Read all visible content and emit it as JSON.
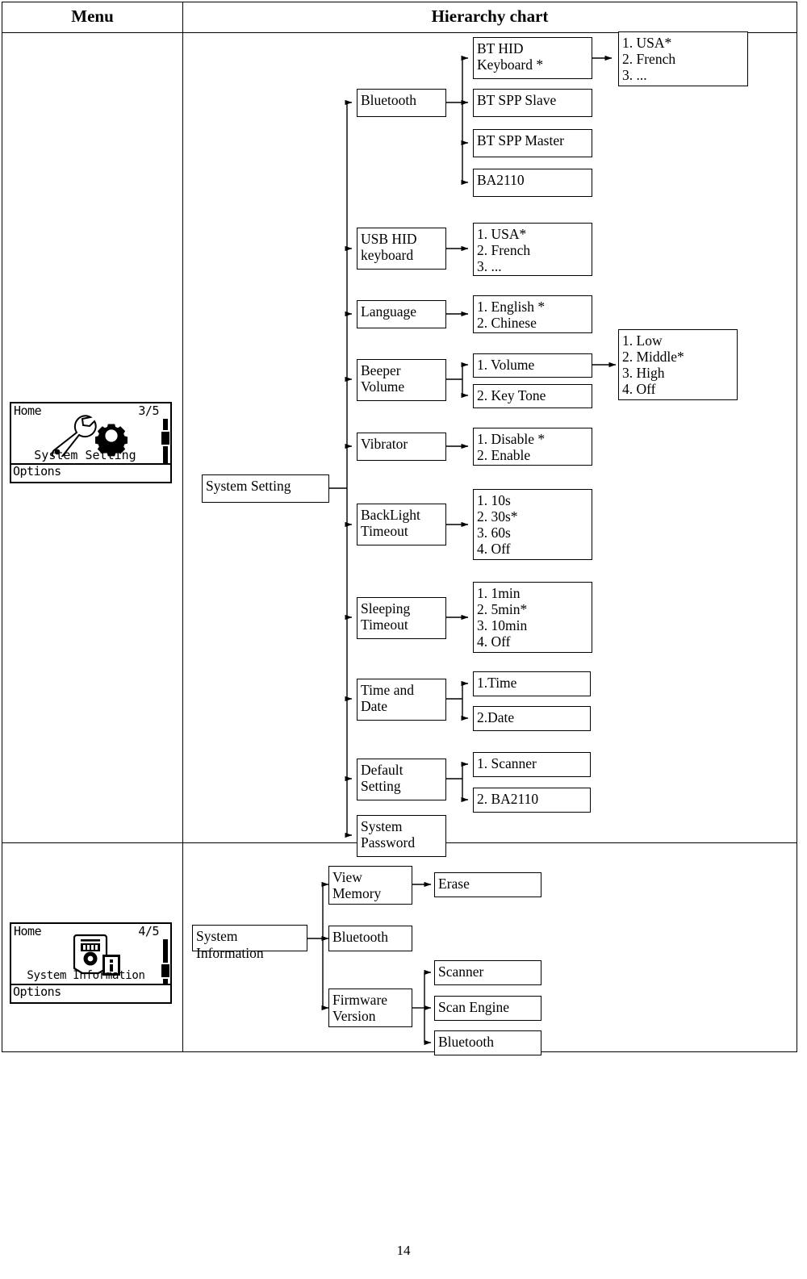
{
  "page": {
    "number": "14"
  },
  "table": {
    "headers": {
      "menu": "Menu",
      "hierarchy": "Hierarchy chart"
    }
  },
  "screens": [
    {
      "home_label": "Home",
      "page_indicator": "3/5",
      "caption": "System Setting",
      "status": "Options",
      "icon": "wrench-gear-icon"
    },
    {
      "home_label": "Home",
      "page_indicator": "4/5",
      "caption": "System Information",
      "status": "Options",
      "icon": "scanner-info-icon"
    }
  ],
  "chart_data": {
    "type": "tree",
    "title": "Hierarchy chart",
    "roots": [
      {
        "id": "system-setting",
        "label": "System Setting",
        "children": [
          {
            "id": "bluetooth",
            "label": "Bluetooth",
            "children": [
              {
                "id": "bt-hid-keyboard",
                "label": "BT HID\nKeyboard *",
                "children": [
                  {
                    "id": "bt-hid-layouts",
                    "label": "1. USA*\n2. French\n3. ..."
                  }
                ]
              },
              {
                "id": "bt-spp-slave",
                "label": "BT SPP Slave"
              },
              {
                "id": "bt-spp-master",
                "label": "BT SPP Master"
              },
              {
                "id": "bt-ba2110",
                "label": "BA2110"
              }
            ]
          },
          {
            "id": "usb-hid-keyboard",
            "label": "USB HID\nkeyboard",
            "children": [
              {
                "id": "usb-hid-layouts",
                "label": "1. USA*\n2. French\n3. ..."
              }
            ]
          },
          {
            "id": "language",
            "label": "Language",
            "children": [
              {
                "id": "language-options",
                "label": "1. English *\n2. Chinese"
              }
            ]
          },
          {
            "id": "beeper-volume",
            "label": "Beeper\nVolume",
            "children": [
              {
                "id": "beeper-volume-sub",
                "label": "1. Volume",
                "children": [
                  {
                    "id": "beeper-levels",
                    "label": "1. Low\n2. Middle*\n3. High\n4. Off"
                  }
                ]
              },
              {
                "id": "beeper-key-tone",
                "label": "2. Key Tone"
              }
            ]
          },
          {
            "id": "vibrator",
            "label": "Vibrator",
            "children": [
              {
                "id": "vibrator-options",
                "label": "1. Disable *\n2. Enable"
              }
            ]
          },
          {
            "id": "backlight-timeout",
            "label": "BackLight\nTimeout",
            "children": [
              {
                "id": "backlight-options",
                "label": "1. 10s\n2. 30s*\n3. 60s\n4. Off"
              }
            ]
          },
          {
            "id": "sleeping-timeout",
            "label": "Sleeping\nTimeout",
            "children": [
              {
                "id": "sleeping-options",
                "label": "1. 1min\n2. 5min*\n3. 10min\n4. Off"
              }
            ]
          },
          {
            "id": "time-and-date",
            "label": "Time and\nDate",
            "children": [
              {
                "id": "time",
                "label": "1.Time"
              },
              {
                "id": "date",
                "label": "2.Date"
              }
            ]
          },
          {
            "id": "default-setting",
            "label": "Default\nSetting",
            "children": [
              {
                "id": "default-scanner",
                "label": "1. Scanner"
              },
              {
                "id": "default-ba2110",
                "label": "2. BA2110"
              }
            ]
          },
          {
            "id": "system-password",
            "label": "System\nPassword"
          }
        ]
      },
      {
        "id": "system-information",
        "label": "System Information",
        "children": [
          {
            "id": "view-memory",
            "label": "View\nMemory",
            "children": [
              {
                "id": "erase",
                "label": "Erase"
              }
            ]
          },
          {
            "id": "info-bluetooth",
            "label": "Bluetooth"
          },
          {
            "id": "firmware-version",
            "label": "Firmware\nVersion",
            "children": [
              {
                "id": "fw-scanner",
                "label": "Scanner"
              },
              {
                "id": "fw-scan-engine",
                "label": "Scan Engine"
              },
              {
                "id": "fw-bluetooth",
                "label": "Bluetooth"
              }
            ]
          }
        ]
      }
    ]
  },
  "nodes": {
    "system_setting": "System Setting",
    "bluetooth": "Bluetooth",
    "bt_hid_keyboard": "BT HID\nKeyboard *",
    "bt_hid_layouts": "1. USA*\n2. French\n3. ...",
    "bt_spp_slave": "BT SPP Slave",
    "bt_spp_master": "BT SPP Master",
    "bt_ba2110": "BA2110",
    "usb_hid_keyboard": "USB HID\nkeyboard",
    "usb_hid_layouts": "1. USA*\n2. French\n3. ...",
    "language": "Language",
    "language_options": "1. English *\n2. Chinese",
    "beeper_volume": "Beeper\nVolume",
    "beeper_volume_sub": "1. Volume",
    "beeper_key_tone": "2. Key Tone",
    "beeper_levels": "1. Low\n2. Middle*\n3. High\n4. Off",
    "vibrator": "Vibrator",
    "vibrator_options": "1. Disable *\n2. Enable",
    "backlight_timeout": "BackLight\nTimeout",
    "backlight_options": "1. 10s\n2. 30s*\n3. 60s\n4. Off",
    "sleeping_timeout": "Sleeping\nTimeout",
    "sleeping_options": "1. 1min\n2. 5min*\n3. 10min\n4. Off",
    "time_and_date": "Time and\nDate",
    "time": "1.Time",
    "date": "2.Date",
    "default_setting": "Default\nSetting",
    "default_scanner": "1. Scanner",
    "default_ba2110": "2. BA2110",
    "system_password": "System\nPassword",
    "system_information": "System Information",
    "view_memory": "View\nMemory",
    "erase": "Erase",
    "info_bluetooth": "Bluetooth",
    "firmware_version": "Firmware\nVersion",
    "fw_scanner": "Scanner",
    "fw_scan_engine": "Scan Engine",
    "fw_bluetooth": "Bluetooth"
  }
}
